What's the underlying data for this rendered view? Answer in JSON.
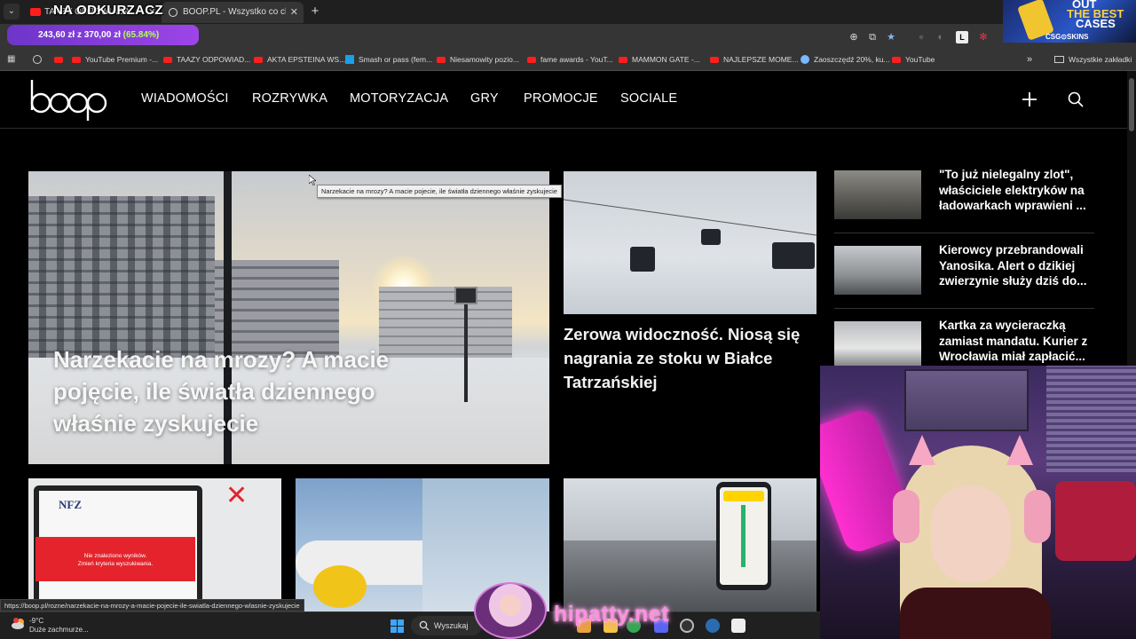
{
  "browser": {
    "overlay_title": "NA ODKURZACZ",
    "tabs": [
      {
        "title": "TAAZY ODPOWIADA...",
        "icon": "youtube-icon"
      },
      {
        "title": "BOOP.PL - Wszystko co chcesz",
        "icon": "boop-icon",
        "active": true
      }
    ],
    "donation": {
      "amount": "243,60 zł",
      "separator": "z",
      "goal": "370,00 zł",
      "percent": "(65.84%)"
    },
    "promo": {
      "line1": "OUT",
      "line2": "THE BEST",
      "line3": "CASES",
      "brand": "CSG⊙SKINS"
    },
    "bookmarks": [
      {
        "label": "",
        "icon": "globe-icon"
      },
      {
        "label": "",
        "icon": "youtube-icon"
      },
      {
        "label": "YouTube Premium -...",
        "icon": "youtube-icon"
      },
      {
        "label": "TAAZY ODPOWIAD...",
        "icon": "youtube-icon"
      },
      {
        "label": "AKTA EPSTEINA WS...",
        "icon": "youtube-icon"
      },
      {
        "label": "Smash or pass (fem...",
        "icon": "blue-icon"
      },
      {
        "label": "Niesamowity pozio...",
        "icon": "youtube-icon"
      },
      {
        "label": "fame awards - YouT...",
        "icon": "youtube-icon"
      },
      {
        "label": "MAMMON GATE -...",
        "icon": "youtube-icon"
      },
      {
        "label": "NAJLEPSZE MOME...",
        "icon": "youtube-icon"
      },
      {
        "label": "Zaoszczędź 20%, ku...",
        "icon": "steam-icon"
      },
      {
        "label": "YouTube",
        "icon": "youtube-icon"
      }
    ],
    "bookmarks_more": "»",
    "bookmarks_all": "Wszystkie zakładki",
    "status_url": "https://boop.pl/rozne/narzekacie-na-mrozy-a-macie-pojecie-ile-swiatla-dziennego-wlasnie-zyskujecie"
  },
  "site": {
    "logo": "boop",
    "nav": [
      "WIADOMOŚCI",
      "ROZRYWKA",
      "MOTORYZACJA",
      "GRY",
      "PROMOCJE",
      "SOCIALE"
    ],
    "hero_title": "Narzekacie na mrozy? A macie pojęcie, ile światła dziennego właśnie zyskujecie",
    "tooltip": "Narzekacie na mrozy? A macie pojecie, ile światła dziennego właśnie zyskujecie",
    "mid_title": "Zerowa widoczność. Niosą się nagrania ze stoku w Białce Tatrzańskiej",
    "sidebar": [
      {
        "title": "\"To już nielegalny zlot\", właściciele elektryków na ładowarkach wprawieni ..."
      },
      {
        "title": "Kierowcy przebrandowali Yanosika. Alert o dzikiej zwierzynie służy dziś do..."
      },
      {
        "title": "Kartka za wycieraczką zamiast mandatu. Kurier z Wrocławia miał zapłacić..."
      }
    ],
    "tile1": {
      "logo": "NFZ",
      "error_line1": "Nie znaleziono wyników.",
      "error_line2": "Zmień kryteria wyszukiwania."
    }
  },
  "taskbar": {
    "weather_temp": "-9°C",
    "weather_desc": "Duże zachmurze...",
    "search": "Wyszukaj"
  },
  "stream": {
    "name": "hipatty.net"
  },
  "colors": {
    "donation_percent": "#b3ff5a",
    "promo_accent": "#ffd23a",
    "nfz_red": "#e5232c",
    "streamer_pink": "#ff8fe0"
  }
}
